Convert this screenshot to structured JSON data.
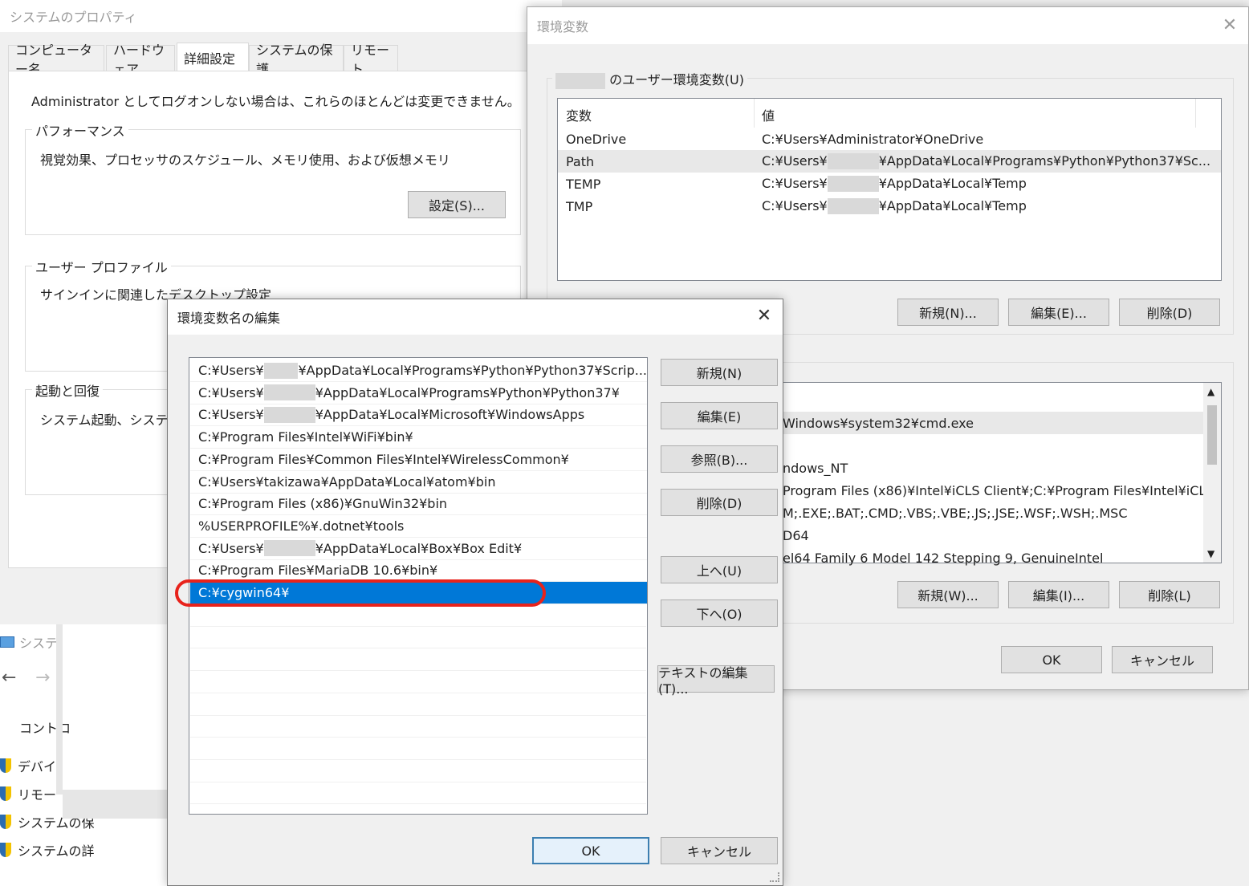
{
  "system_properties": {
    "title": "システムのプロパティ",
    "tabs": [
      "コンピューター名",
      "ハードウェア",
      "詳細設定",
      "システムの保護",
      "リモート"
    ],
    "admin_note": "Administrator としてログオンしない場合は、これらのほとんどは変更できません。",
    "performance": {
      "legend": "パフォーマンス",
      "desc": "視覚効果、プロセッサのスケジュール、メモリ使用、および仮想メモリ",
      "settings_button": "設定(S)..."
    },
    "user_profile": {
      "legend": "ユーザー プロファイル",
      "desc": "サインインに関連したデスクトップ設定"
    },
    "startup": {
      "legend": "起動と回復",
      "desc": "システム起動、システム"
    }
  },
  "background_window": {
    "title": "システ",
    "nav_back": "←",
    "nav_forward": "→",
    "control_label": "コントロ",
    "links": [
      "デバイ",
      "リモー",
      "システムの保",
      "システムの詳"
    ]
  },
  "env_vars": {
    "title": "環境変数",
    "user_legend": "のユーザー環境変数(U)",
    "columns": [
      "変数",
      "値"
    ],
    "user_vars": [
      {
        "name": "OneDrive",
        "value_pre": "C:¥Users¥Administrator¥OneDrive",
        "value_post": ""
      },
      {
        "name": "Path",
        "value_pre": "C:¥Users¥",
        "value_post": "¥AppData¥Local¥Programs¥Python¥Python37¥Sc..."
      },
      {
        "name": "TEMP",
        "value_pre": "C:¥Users¥",
        "value_post": "¥AppData¥Local¥Temp"
      },
      {
        "name": "TMP",
        "value_pre": "C:¥Users¥",
        "value_post": "¥AppData¥Local¥Temp"
      }
    ],
    "user_buttons": {
      "new": "新規(N)...",
      "edit": "編集(E)...",
      "delete": "削除(D)"
    },
    "system_vars_visible": [
      "Windows¥system32¥cmd.exe",
      "",
      "ndows_NT",
      "Program Files (x86)¥Intel¥iCLS Client¥;C:¥Program Files¥Intel¥iCL...",
      "M;.EXE;.BAT;.CMD;.VBS;.VBE;.JS;.JSE;.WSF;.WSH;.MSC",
      "D64",
      "el64 Family 6 Model 142 Stepping 9, GenuineIntel"
    ],
    "system_buttons": {
      "new": "新規(W)...",
      "edit": "編集(I)...",
      "delete": "削除(L)"
    },
    "ok": "OK",
    "cancel": "キャンセル"
  },
  "edit_dialog": {
    "title": "環境変数名の編集",
    "entries": [
      {
        "pre": "C:¥Users¥",
        "post": "¥AppData¥Local¥Programs¥Python¥Python37¥Scrip...",
        "redacted": true
      },
      {
        "pre": "C:¥Users¥",
        "post": "¥AppData¥Local¥Programs¥Python¥Python37¥",
        "redacted": true
      },
      {
        "pre": "C:¥Users¥",
        "post": "¥AppData¥Local¥Microsoft¥WindowsApps",
        "redacted": true
      },
      {
        "pre": "C:¥Program Files¥Intel¥WiFi¥bin¥",
        "post": "",
        "redacted": false
      },
      {
        "pre": "C:¥Program Files¥Common Files¥Intel¥WirelessCommon¥",
        "post": "",
        "redacted": false
      },
      {
        "pre": "C:¥Users¥takizawa¥AppData¥Local¥atom¥bin",
        "post": "",
        "redacted": false
      },
      {
        "pre": "C:¥Program Files (x86)¥GnuWin32¥bin",
        "post": "",
        "redacted": false
      },
      {
        "pre": "%USERPROFILE%¥.dotnet¥tools",
        "post": "",
        "redacted": false
      },
      {
        "pre": "C:¥Users¥",
        "post": "¥AppData¥Local¥Box¥Box Edit¥",
        "redacted": true
      },
      {
        "pre": "C:¥Program Files¥MariaDB 10.6¥bin¥",
        "post": "",
        "redacted": false
      },
      {
        "pre": "C:¥cygwin64¥",
        "post": "",
        "redacted": false
      }
    ],
    "selected_index": 10,
    "buttons": {
      "new": "新規(N)",
      "edit": "編集(E)",
      "browse": "参照(B)...",
      "delete": "削除(D)",
      "up": "上へ(U)",
      "down": "下へ(O)",
      "edit_text": "テキストの編集(T)..."
    },
    "ok": "OK",
    "cancel": "キャンセル"
  },
  "colors": {
    "selection": "#0078d7",
    "highlight_ring": "#e8231c",
    "row_hover": "#e5e5e5"
  }
}
